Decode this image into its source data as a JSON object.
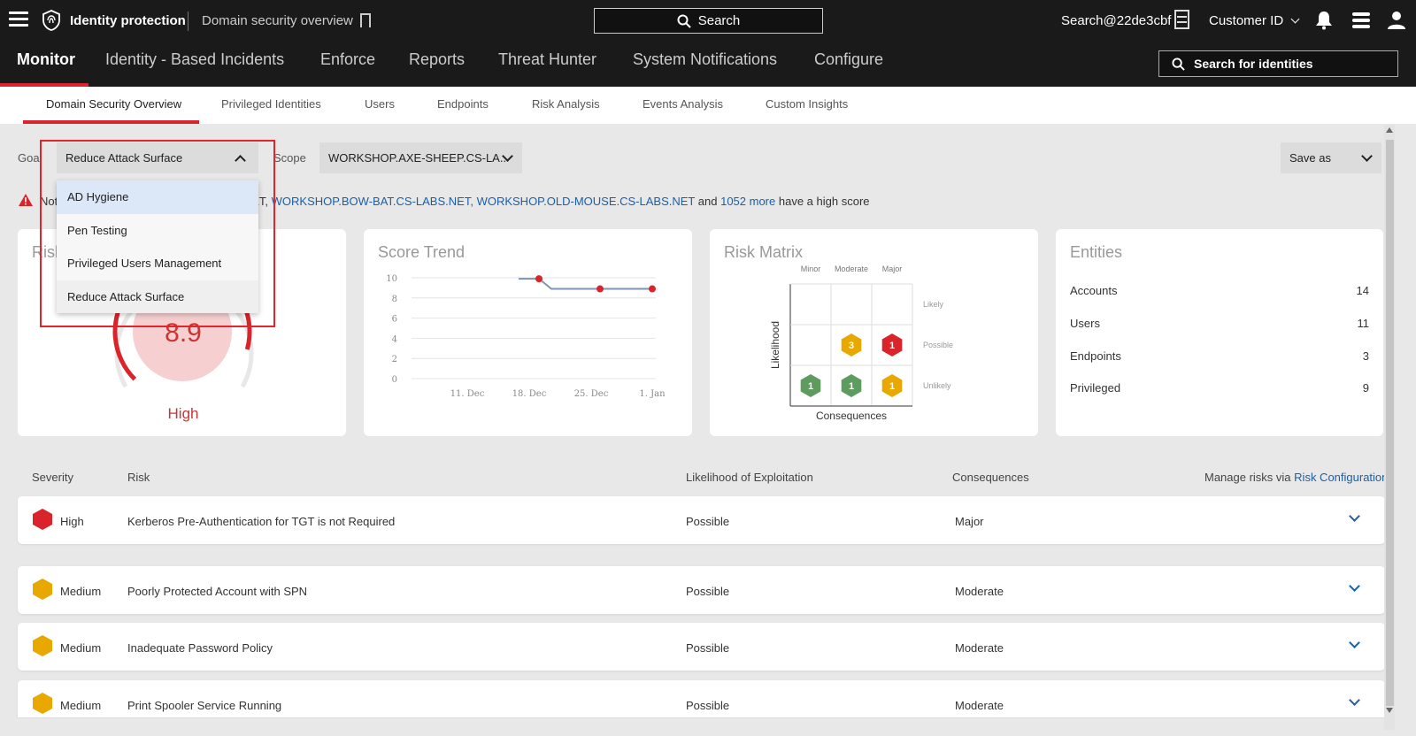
{
  "topbar": {
    "brand": "Identity protection",
    "breadcrumb": "Domain security overview",
    "search_label": "Search",
    "user": "Search@22de3cbf",
    "customer": "Customer ID"
  },
  "nav": {
    "items": [
      "Monitor",
      "Identity - Based Incidents",
      "Enforce",
      "Reports",
      "Threat Hunter",
      "System Notifications",
      "Configure"
    ],
    "identity_search": "Search for identities"
  },
  "subnav": {
    "items": [
      "Domain Security Overview",
      "Privileged Identities",
      "Users",
      "Endpoints",
      "Risk Analysis",
      "Events Analysis",
      "Custom Insights"
    ]
  },
  "controls": {
    "goal_label": "Goal",
    "goal_value": "Reduce Attack Surface",
    "goal_options": [
      "AD Hygiene",
      "Pen Testing",
      "Privileged Users Management",
      "Reduce Attack Surface"
    ],
    "scope_label": "Scope",
    "scope_value": "WORKSHOP.AXE-SHEEP.CS-LA..",
    "save_as": "Save as"
  },
  "notice": {
    "prefix": "Not",
    "partial": "ET,",
    "domain1": "WORKSHOP.BOW-BAT.CS-LABS.NET,",
    "domain2": "WORKSHOP.OLD-MOUSE.CS-LABS.NET",
    "and": "and",
    "more": "1052 more",
    "suffix": "have a high score"
  },
  "risk_card": {
    "title_partial": "Risl",
    "score": "8.9",
    "level": "High",
    "score_max": 10,
    "color": "#d8242a"
  },
  "score_trend": {
    "title": "Score Trend",
    "chart_data": {
      "type": "line",
      "y_ticks": [
        "10",
        "8",
        "6",
        "4",
        "2",
        "0"
      ],
      "x_ticks": [
        "11. Dec",
        "18. Dec",
        "25. Dec",
        "1. Jan"
      ],
      "ylim": [
        0,
        10
      ],
      "values": [
        9.9,
        9.9,
        8.9,
        8.9,
        8.9
      ],
      "marker_values": [
        9.9,
        8.9,
        8.9
      ]
    }
  },
  "risk_matrix": {
    "title": "Risk Matrix",
    "columns": [
      "Minor",
      "Moderate",
      "Major"
    ],
    "rows": [
      "Likely",
      "Possible",
      "Unlikely"
    ],
    "ylabel": "Likelihood",
    "xlabel": "Consequences",
    "cells": [
      {
        "row": 1,
        "col": 1,
        "count": "3",
        "color": "#e8a800"
      },
      {
        "row": 1,
        "col": 2,
        "count": "1",
        "color": "#d8242a"
      },
      {
        "row": 2,
        "col": 0,
        "count": "1",
        "color": "#5e9b5e"
      },
      {
        "row": 2,
        "col": 1,
        "count": "1",
        "color": "#5e9b5e"
      },
      {
        "row": 2,
        "col": 2,
        "count": "1",
        "color": "#e8a800"
      }
    ]
  },
  "entities": {
    "title": "Entities",
    "rows": [
      {
        "label": "Accounts",
        "value": "14"
      },
      {
        "label": "Users",
        "value": "11"
      },
      {
        "label": "Endpoints",
        "value": "3"
      },
      {
        "label": "Privileged",
        "value": "9"
      }
    ]
  },
  "risks_table": {
    "headers": [
      "Severity",
      "Risk",
      "Likelihood of Exploitation",
      "Consequences"
    ],
    "manage_prefix": "Manage risks via",
    "manage_link": "Risk Configuration",
    "rows": [
      {
        "severity": "High",
        "color": "#d8242a",
        "risk": "Kerberos Pre-Authentication for TGT is not Required",
        "likelihood": "Possible",
        "consequence": "Major"
      },
      {
        "severity": "Medium",
        "color": "#e8a800",
        "risk": "Poorly Protected Account with SPN",
        "likelihood": "Possible",
        "consequence": "Moderate"
      },
      {
        "severity": "Medium",
        "color": "#e8a800",
        "risk": "Inadequate Password Policy",
        "likelihood": "Possible",
        "consequence": "Moderate"
      },
      {
        "severity": "Medium",
        "color": "#e8a800",
        "risk": "Print Spooler Service Running",
        "likelihood": "Possible",
        "consequence": "Moderate"
      }
    ]
  }
}
